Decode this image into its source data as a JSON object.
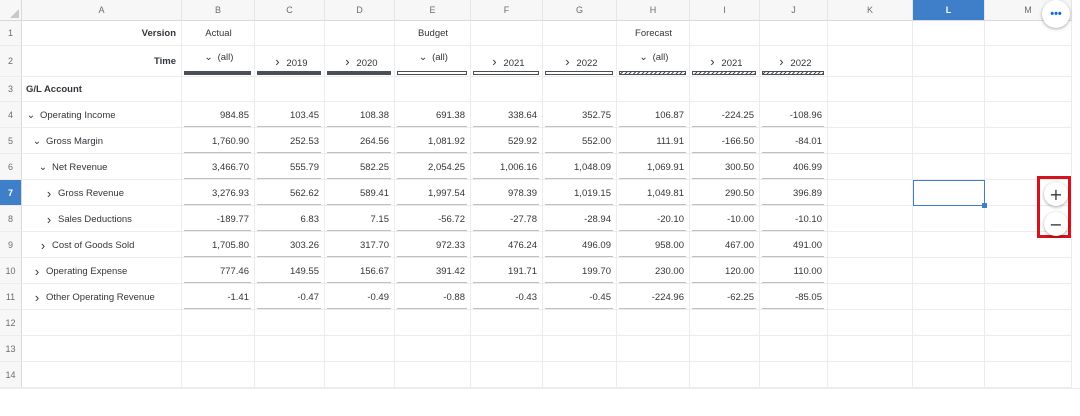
{
  "columns": [
    "A",
    "B",
    "C",
    "D",
    "E",
    "F",
    "G",
    "H",
    "I",
    "J",
    "K",
    "L",
    "M"
  ],
  "selected_column": "L",
  "row_numbers": [
    "1",
    "2",
    "3",
    "4",
    "5",
    "6",
    "7",
    "8",
    "9",
    "10",
    "11",
    "12",
    "13",
    "14"
  ],
  "selected_row": "7",
  "header": {
    "version_label": "Version",
    "time_label": "Time",
    "gl_account_label": "G/L Account",
    "versions": [
      {
        "name": "Actual",
        "all": "(all)",
        "years": [
          "2019",
          "2020"
        ]
      },
      {
        "name": "Budget",
        "all": "(all)",
        "years": [
          "2021",
          "2022"
        ]
      },
      {
        "name": "Forecast",
        "all": "(all)",
        "years": [
          "2021",
          "2022"
        ]
      }
    ]
  },
  "rows": [
    {
      "account": "Operating Income",
      "expanded": true,
      "level": 0,
      "values": [
        "984.85",
        "103.45",
        "108.38",
        "691.38",
        "338.64",
        "352.75",
        "106.87",
        "-224.25",
        "-108.96"
      ]
    },
    {
      "account": "Gross Margin",
      "expanded": true,
      "level": 1,
      "values": [
        "1,760.90",
        "252.53",
        "264.56",
        "1,081.92",
        "529.92",
        "552.00",
        "111.91",
        "-166.50",
        "-84.01"
      ]
    },
    {
      "account": "Net Revenue",
      "expanded": true,
      "level": 2,
      "values": [
        "3,466.70",
        "555.79",
        "582.25",
        "2,054.25",
        "1,006.16",
        "1,048.09",
        "1,069.91",
        "300.50",
        "406.99"
      ]
    },
    {
      "account": "Gross Revenue",
      "expanded": false,
      "level": 3,
      "values": [
        "3,276.93",
        "562.62",
        "589.41",
        "1,997.54",
        "978.39",
        "1,019.15",
        "1,049.81",
        "290.50",
        "396.89"
      ]
    },
    {
      "account": "Sales Deductions",
      "expanded": false,
      "level": 3,
      "values": [
        "-189.77",
        "6.83",
        "7.15",
        "-56.72",
        "-27.78",
        "-28.94",
        "-20.10",
        "-10.00",
        "-10.10"
      ]
    },
    {
      "account": "Cost of Goods Sold",
      "expanded": false,
      "level": 2,
      "values": [
        "1,705.80",
        "303.26",
        "317.70",
        "972.33",
        "476.24",
        "496.09",
        "958.00",
        "467.00",
        "491.00"
      ]
    },
    {
      "account": "Operating Expense",
      "expanded": false,
      "level": 1,
      "values": [
        "777.46",
        "149.55",
        "156.67",
        "391.42",
        "191.71",
        "199.70",
        "230.00",
        "120.00",
        "110.00"
      ]
    },
    {
      "account": "Other Operating Revenue",
      "expanded": false,
      "level": 1,
      "values": [
        "-1.41",
        "-0.47",
        "-0.49",
        "-0.88",
        "-0.43",
        "-0.45",
        "-224.96",
        "-62.25",
        "-85.05"
      ]
    }
  ],
  "icons": {
    "expanded": "chevron-down-icon",
    "collapsed": "chevron-right-icon",
    "add": "plus-icon",
    "remove": "minus-icon",
    "more": "more-icon"
  },
  "buttons": {
    "add": "+",
    "remove": "−",
    "more": "•••"
  },
  "colors": {
    "selection": "#3f7fc9",
    "highlight_frame": "#d5121d"
  }
}
